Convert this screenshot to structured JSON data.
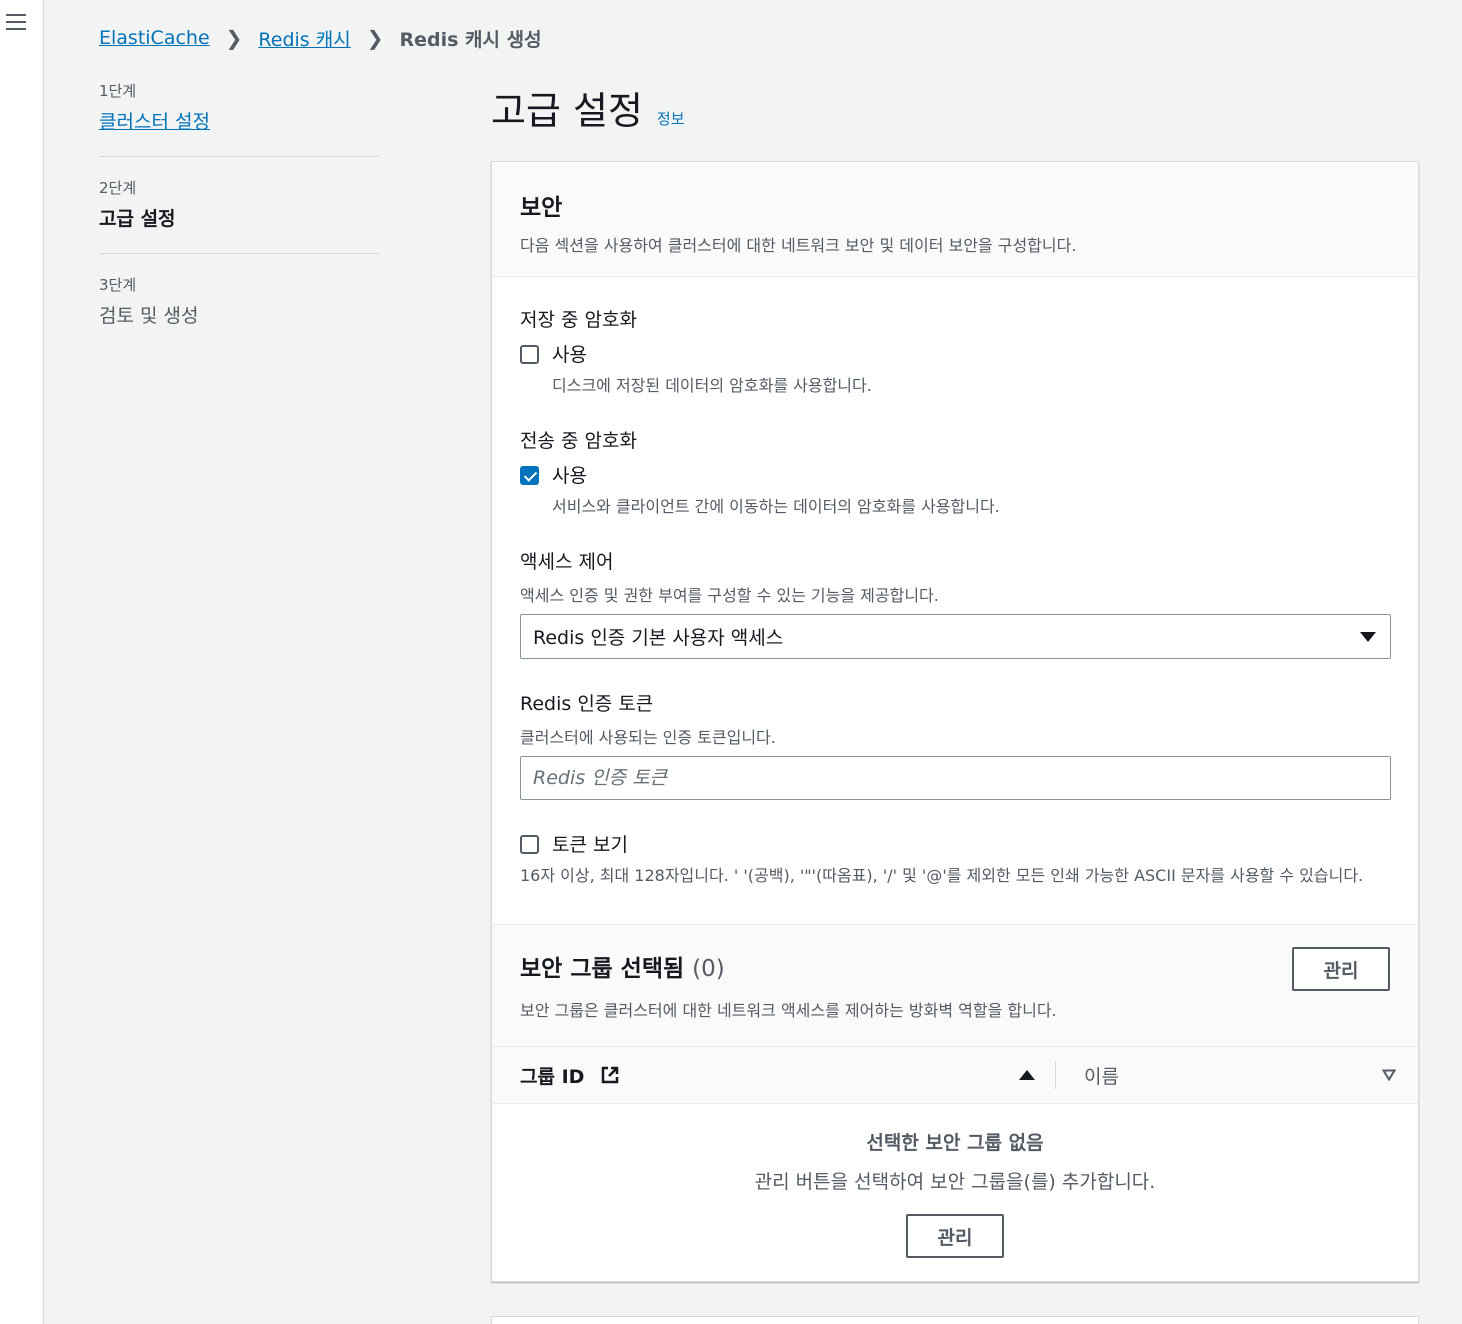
{
  "breadcrumb": {
    "items": [
      "ElastiCache",
      "Redis 캐시"
    ],
    "current": "Redis 캐시 생성"
  },
  "steps": [
    {
      "num": "1단계",
      "label": "클러스터 설정"
    },
    {
      "num": "2단계",
      "label": "고급 설정"
    },
    {
      "num": "3단계",
      "label": "검토 및 생성"
    }
  ],
  "page": {
    "title": "고급 설정",
    "info": "정보"
  },
  "security": {
    "title": "보안",
    "description": "다음 섹션을 사용하여 클러스터에 대한 네트워크 보안 및 데이터 보안을 구성합니다.",
    "encryption_at_rest": {
      "label": "저장 중 암호화",
      "option": "사용",
      "option_desc": "디스크에 저장된 데이터의 암호화를 사용합니다.",
      "checked": false
    },
    "encryption_in_transit": {
      "label": "전송 중 암호화",
      "option": "사용",
      "option_desc": "서비스와 클라이언트 간에 이동하는 데이터의 암호화를 사용합니다.",
      "checked": true
    },
    "access_control": {
      "label": "액세스 제어",
      "desc": "액세스 인증 및 권한 부여를 구성할 수 있는 기능을 제공합니다.",
      "selected": "Redis 인증 기본 사용자 액세스"
    },
    "auth_token": {
      "label": "Redis 인증 토큰",
      "desc": "클러스터에 사용되는 인증 토큰입니다.",
      "placeholder": "Redis 인증 토큰",
      "value": ""
    },
    "show_token": {
      "label": "토큰 보기",
      "checked": false
    },
    "token_hint": "16자 이상, 최대 128자입니다. ' '(공백), '\"'(따옴표), '/' 및 '@'를 제외한 모든 인쇄 가능한 ASCII 문자를 사용할 수 있습니다."
  },
  "security_groups": {
    "title": "보안 그룹 선택됨",
    "count": "(0)",
    "desc": "보안 그룹은 클러스터에 대한 네트워크 액세스를 제어하는 방화벽 역할을 합니다.",
    "manage_label": "관리",
    "columns": [
      "그룹 ID",
      "이름"
    ],
    "empty_title": "선택한 보안 그룹 없음",
    "empty_desc": "관리 버튼을 선택하여 보안 그룹을(를) 추가합니다.",
    "empty_manage_label": "관리"
  },
  "colors": {
    "link": "#0073bb",
    "text": "#16191f",
    "secondary": "#545b64",
    "background": "#f2f3f3"
  }
}
